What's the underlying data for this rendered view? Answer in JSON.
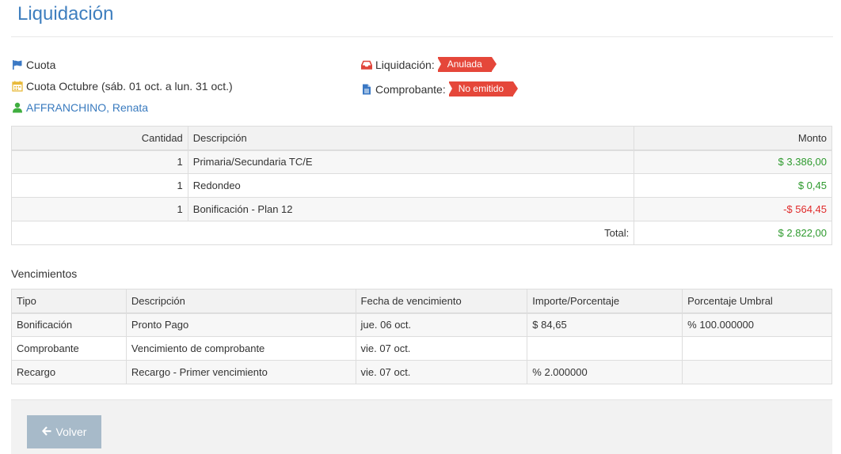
{
  "header": {
    "title": "Liquidación"
  },
  "info": {
    "type_label": "Cuota",
    "period_label": "Cuota Octubre (sáb. 01 oct. a lun. 31 oct.)",
    "person_name": "AFFRANCHINO, Renata",
    "liquidacion_label": "Liquidación:",
    "liquidacion_status": "Anulada",
    "comprobante_label": "Comprobante:",
    "comprobante_status": "No emitido"
  },
  "icons": {
    "flag": "flag-icon",
    "calendar": "calendar-icon",
    "user": "user-icon",
    "inbox": "inbox-icon",
    "document": "document-icon",
    "arrow": "arrow-left-icon"
  },
  "colors": {
    "title": "#3f7fbf",
    "link": "#3a7bbf",
    "badge": "#e5473a",
    "positive": "#2e9a2e",
    "negative": "#e02b2b",
    "button": "#a7bac9"
  },
  "items_table": {
    "headers": {
      "cantidad": "Cantidad",
      "descripcion": "Descripción",
      "monto": "Monto"
    },
    "rows": [
      {
        "cantidad": "1",
        "descripcion": "Primaria/Secundaria TC/E",
        "monto": "$ 3.386,00"
      },
      {
        "cantidad": "1",
        "descripcion": "Redondeo",
        "monto": "$ 0,45"
      },
      {
        "cantidad": "1",
        "descripcion": "Bonificación - Plan 12",
        "monto": "-$ 564,45"
      }
    ],
    "total_label": "Total:",
    "total_value": "$ 2.822,00"
  },
  "vencimientos": {
    "title": "Vencimientos",
    "headers": [
      "Tipo",
      "Descripción",
      "Fecha de vencimiento",
      "Importe/Porcentaje",
      "Porcentaje Umbral"
    ],
    "rows": [
      {
        "tipo": "Bonificación",
        "descripcion": "Pronto Pago",
        "fecha": "jue. 06 oct.",
        "importe": "$ 84,65",
        "umbral": "% 100.000000"
      },
      {
        "tipo": "Comprobante",
        "descripcion": "Vencimiento de comprobante",
        "fecha": "vie. 07 oct.",
        "importe": "",
        "umbral": ""
      },
      {
        "tipo": "Recargo",
        "descripcion": "Recargo - Primer vencimiento",
        "fecha": "vie. 07 oct.",
        "importe": "% 2.000000",
        "umbral": ""
      }
    ]
  },
  "footer": {
    "back_label": "Volver"
  }
}
